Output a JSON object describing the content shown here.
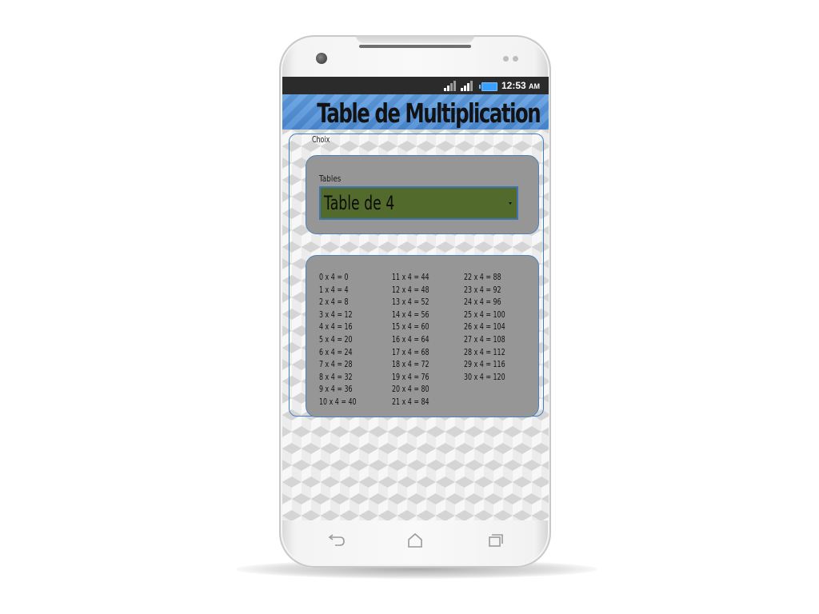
{
  "status_bar": {
    "time": "12:53",
    "ampm": "AM",
    "icons": [
      "signal-icon",
      "signal-icon",
      "battery-icon"
    ]
  },
  "app": {
    "title": "Table de Multiplication"
  },
  "choice": {
    "section_label": "Choix",
    "tables_label": "Tables",
    "selected": "Table de 4"
  },
  "results": {
    "column1": [
      "0 x 4 = 0",
      "1 x 4 = 4",
      "2 x 4 = 8",
      "3 x 4 = 12",
      "4 x 4 = 16",
      "5 x 4 = 20",
      "6 x 4 = 24",
      "7 x 4 = 28",
      "8 x 4 = 32",
      "9 x 4 = 36",
      "10 x 4 = 40"
    ],
    "column2": [
      "11 x 4 = 44",
      "12 x 4 = 48",
      "13 x 4 = 52",
      "14 x 4 = 56",
      "15 x 4 = 60",
      "16 x 4 = 64",
      "17 x 4 = 68",
      "18 x 4 = 72",
      "19 x 4 = 76",
      "20 x 4 = 80",
      "21 x 4 = 84"
    ],
    "column3": [
      "22 x 4 = 88",
      "23 x 4 = 92",
      "24 x 4 = 96",
      "25 x 4 = 100",
      "26 x 4 = 104",
      "27 x 4 = 108",
      "28 x 4 = 112",
      "29 x 4 = 116",
      "30 x 4 = 120"
    ]
  },
  "nav": {
    "icons": [
      "back-icon",
      "home-icon",
      "recent-apps-icon"
    ]
  },
  "colors": {
    "appbar": "#4a89d2",
    "card": "#969696",
    "card_border": "#4a80bb",
    "select_bg": "#526a2b",
    "statusbar": "#2b2b2b"
  }
}
